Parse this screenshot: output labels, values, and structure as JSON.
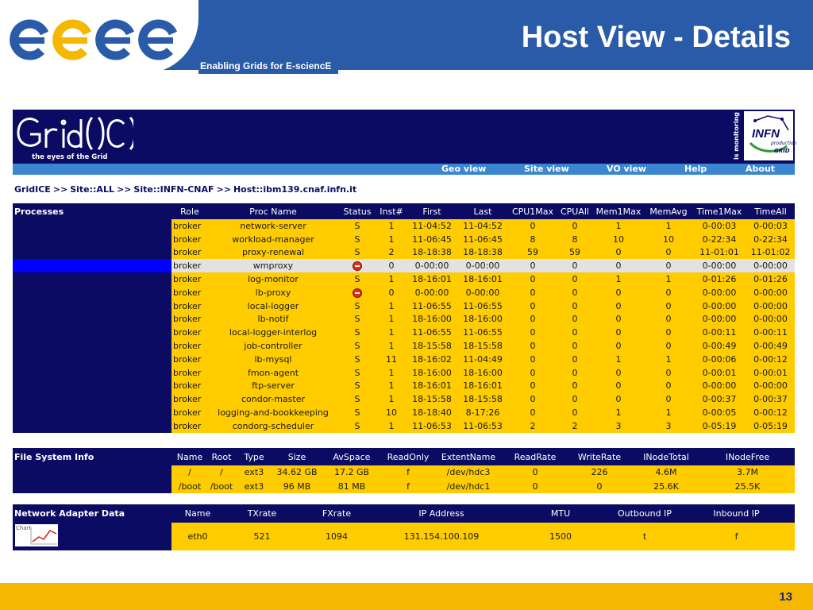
{
  "slide": {
    "title": "Host View - Details",
    "subtitle": "Enabling Grids for E-sciencE",
    "page_number": "13",
    "colors": {
      "header_blue": "#2a5ba8",
      "footer_yellow": "#f5b700"
    }
  },
  "gridice": {
    "tagline": "the eyes of the Grid",
    "monitoring_label": "is monitoring",
    "infn_logo": {
      "text": "INFN",
      "sub1": "production",
      "sub2": "GRID"
    },
    "nav": [
      "Geo view",
      "Site view",
      "VO view",
      "Help",
      "About"
    ],
    "breadcrumb": [
      "GridICE",
      "Site::ALL",
      "Site::INFN-CNAF",
      "Host::ibm139.cnaf.infn.it"
    ],
    "colors": {
      "navy": "#0b0b63",
      "row_yellow": "#ffcc00",
      "nav_blue": "#3a86d0",
      "selected_row": "#e2e2e2"
    }
  },
  "processes": {
    "section_label": "Processes",
    "columns": [
      "Role",
      "Proc Name",
      "Status",
      "Inst#",
      "First",
      "Last",
      "CPU1Max",
      "CPUAll",
      "Mem1Max",
      "MemAvg",
      "Time1Max",
      "TimeAll"
    ],
    "rows": [
      [
        "broker",
        "network-server",
        "S",
        "1",
        "11-04:52",
        "11-04:52",
        "0",
        "0",
        "1",
        "1",
        "0-00:03",
        "0-00:03"
      ],
      [
        "broker",
        "workload-manager",
        "S",
        "1",
        "11-06:45",
        "11-06:45",
        "8",
        "8",
        "10",
        "10",
        "0-22:34",
        "0-22:34"
      ],
      [
        "broker",
        "proxy-renewal",
        "S",
        "2",
        "18-18:38",
        "18-18:38",
        "59",
        "59",
        "0",
        "0",
        "11-01:01",
        "11-01:02"
      ],
      [
        "broker",
        "wmproxy",
        "stop-icon",
        "0",
        "0-00:00",
        "0-00:00",
        "0",
        "0",
        "0",
        "0",
        "0-00:00",
        "0-00:00"
      ],
      [
        "broker",
        "log-monitor",
        "S",
        "1",
        "18-16:01",
        "18-16:01",
        "0",
        "0",
        "1",
        "1",
        "0-01:26",
        "0-01:26"
      ],
      [
        "broker",
        "lb-proxy",
        "stop-icon",
        "0",
        "0-00:00",
        "0-00:00",
        "0",
        "0",
        "0",
        "0",
        "0-00:00",
        "0-00:00"
      ],
      [
        "broker",
        "local-logger",
        "S",
        "1",
        "11-06:55",
        "11-06:55",
        "0",
        "0",
        "0",
        "0",
        "0-00:00",
        "0-00:00"
      ],
      [
        "broker",
        "lb-notif",
        "S",
        "1",
        "18-16:00",
        "18-16:00",
        "0",
        "0",
        "0",
        "0",
        "0-00:00",
        "0-00:00"
      ],
      [
        "broker",
        "local-logger-interlog",
        "S",
        "1",
        "11-06:55",
        "11-06:55",
        "0",
        "0",
        "0",
        "0",
        "0-00:11",
        "0-00:11"
      ],
      [
        "broker",
        "job-controller",
        "S",
        "1",
        "18-15:58",
        "18-15:58",
        "0",
        "0",
        "0",
        "0",
        "0-00:49",
        "0-00:49"
      ],
      [
        "broker",
        "lb-mysql",
        "S",
        "11",
        "18-16:02",
        "11-04:49",
        "0",
        "0",
        "1",
        "1",
        "0-00:06",
        "0-00:12"
      ],
      [
        "broker",
        "fmon-agent",
        "S",
        "1",
        "18-16:00",
        "18-16:00",
        "0",
        "0",
        "0",
        "0",
        "0-00:01",
        "0-00:01"
      ],
      [
        "broker",
        "ftp-server",
        "S",
        "1",
        "18-16:01",
        "18-16:01",
        "0",
        "0",
        "0",
        "0",
        "0-00:00",
        "0-00:00"
      ],
      [
        "broker",
        "condor-master",
        "S",
        "1",
        "18-15:58",
        "18-15:58",
        "0",
        "0",
        "0",
        "0",
        "0-00:37",
        "0-00:37"
      ],
      [
        "broker",
        "logging-and-bookkeeping",
        "S",
        "10",
        "18-18:40",
        "8-17:26",
        "0",
        "0",
        "1",
        "1",
        "0-00:05",
        "0-00:12"
      ],
      [
        "broker",
        "condorg-scheduler",
        "S",
        "1",
        "11-06:53",
        "11-06:53",
        "2",
        "2",
        "3",
        "3",
        "0-05:19",
        "0-05:19"
      ]
    ],
    "selected_row": 3
  },
  "filesystem": {
    "section_label": "File System Info",
    "columns": [
      "Name",
      "Root",
      "Type",
      "Size",
      "AvSpace",
      "ReadOnly",
      "ExtentName",
      "ReadRate",
      "WriteRate",
      "INodeTotal",
      "INodeFree"
    ],
    "rows": [
      [
        "/",
        "/",
        "ext3",
        "34.62 GB",
        "17.2 GB",
        "f",
        "/dev/hdc3",
        "0",
        "226",
        "4.6M",
        "3.7M"
      ],
      [
        "/boot",
        "/boot",
        "ext3",
        "96 MB",
        "81 MB",
        "f",
        "/dev/hdc1",
        "0",
        "0",
        "25.6K",
        "25.5K"
      ]
    ]
  },
  "network": {
    "section_label": "Network Adapter Data",
    "chart_label": "Chart",
    "columns": [
      "Name",
      "TXrate",
      "FXrate",
      "IP Address",
      "MTU",
      "Outbound IP",
      "Inbound IP"
    ],
    "rows": [
      [
        "eth0",
        "521",
        "1094",
        "131.154.100.109",
        "1500",
        "t",
        "f"
      ]
    ]
  }
}
